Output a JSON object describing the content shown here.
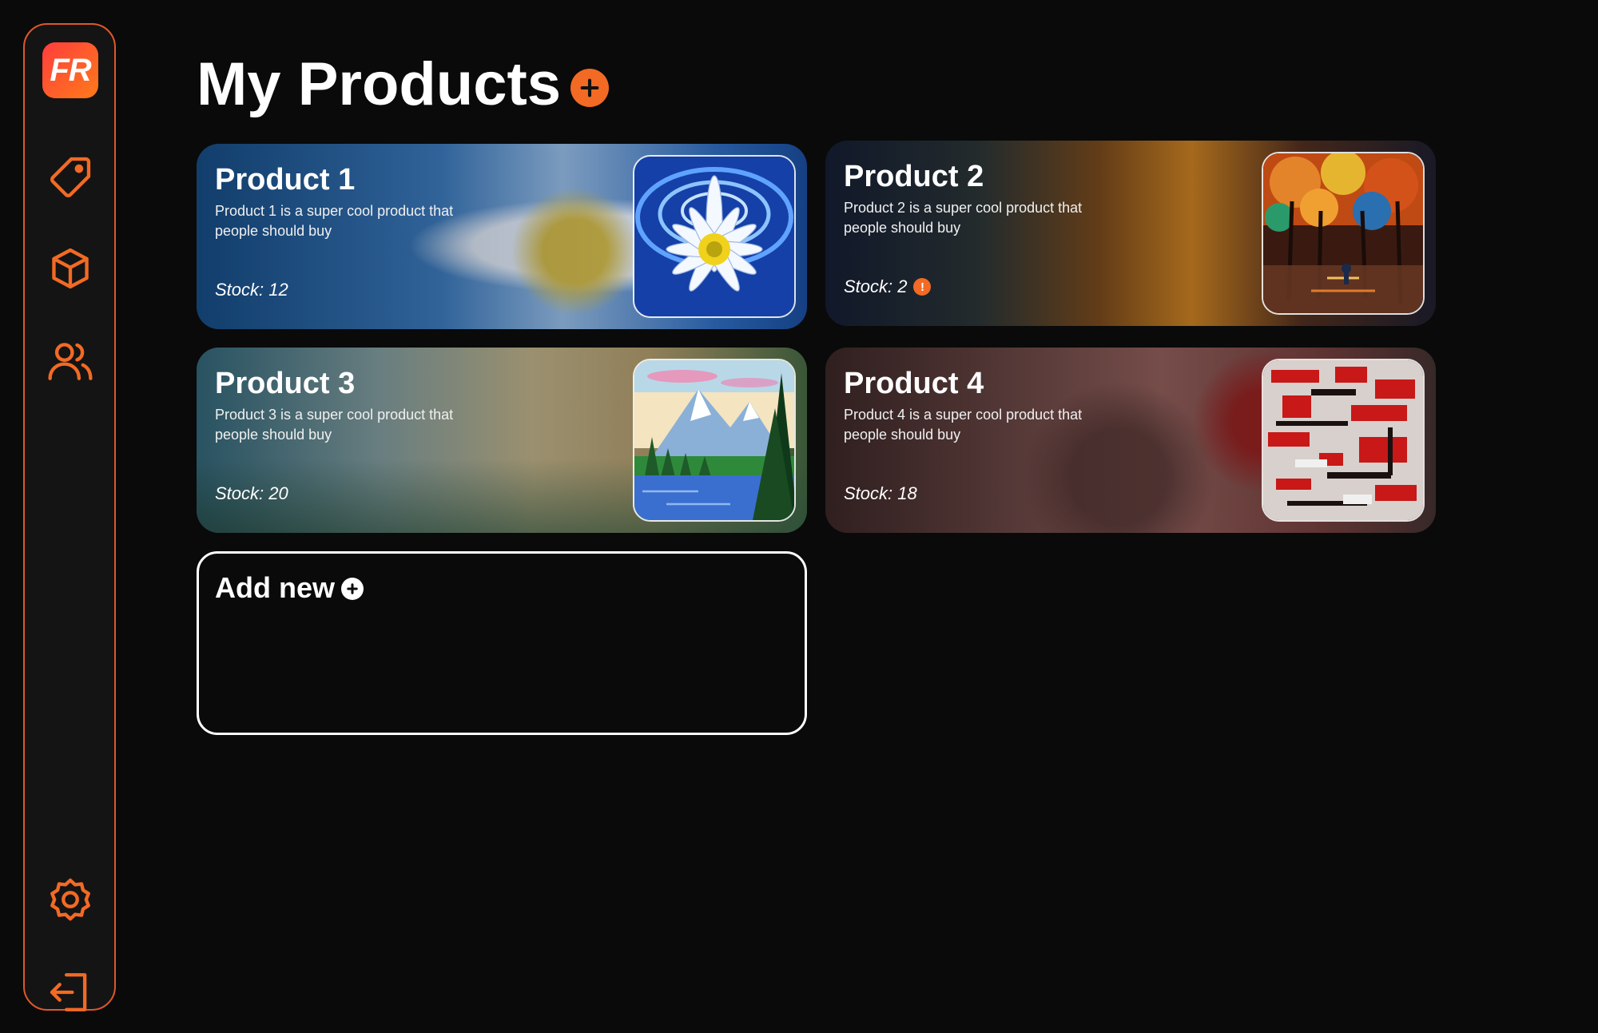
{
  "sidebar": {
    "logo_text": "FR",
    "items": [
      {
        "icon": "tag-icon"
      },
      {
        "icon": "box-icon"
      },
      {
        "icon": "users-icon"
      },
      {
        "icon": "gear-icon"
      },
      {
        "icon": "logout-icon"
      }
    ],
    "accent": "#f26a24"
  },
  "header": {
    "title": "My Products",
    "add_icon": "plus-circle-icon"
  },
  "products": [
    {
      "name": "Product 1",
      "description": "Product 1 is a super cool product that people should buy",
      "stock": "Stock: 12",
      "low_stock": false,
      "image": "daisy-on-water-painting"
    },
    {
      "name": "Product 2",
      "description": "Product 2 is a super cool product that people should buy",
      "stock": "Stock: 2",
      "low_stock": true,
      "image": "autumn-street-painting"
    },
    {
      "name": "Product 3",
      "description": "Product 3 is a super cool product that people should buy",
      "stock": "Stock: 20",
      "low_stock": false,
      "image": "mountain-lake-painting"
    },
    {
      "name": "Product 4",
      "description": "Product 4 is a super cool product that people should buy",
      "stock": "Stock: 18",
      "low_stock": false,
      "image": "red-abstract-painting"
    }
  ],
  "add_new": {
    "label": "Add new",
    "icon": "plus-circle-icon"
  },
  "colors": {
    "background": "#0a0a0a",
    "sidebar_border": "#e0572a",
    "warning": "#f26a24"
  }
}
